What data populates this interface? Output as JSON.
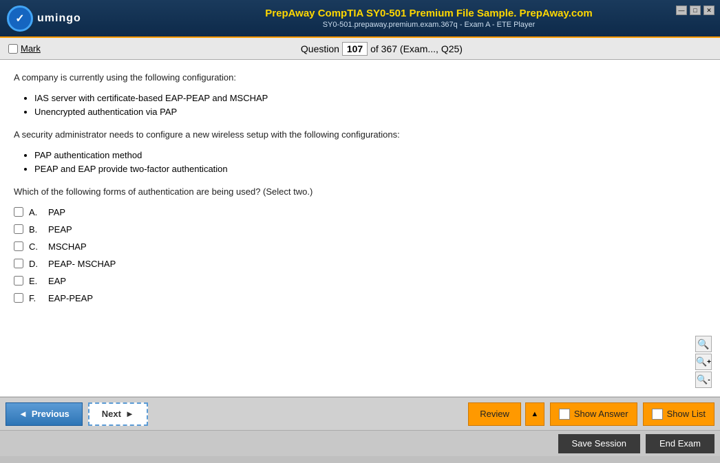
{
  "titleBar": {
    "title": "PrepAway CompTIA SY0-501 Premium File Sample. PrepAway.com",
    "subtitle": "SY0-501.prepaway.premium.exam.367q - Exam A - ETE Player",
    "controls": [
      "minimize",
      "maximize",
      "close"
    ]
  },
  "toolbar": {
    "markLabel": "Mark",
    "questionLabel": "Question",
    "questionNumber": "107",
    "questionTotal": "of 367 (Exam..., Q25)"
  },
  "question": {
    "intro": "A company is currently using the following configuration:",
    "bulletItems": [
      "IAS server with certificate-based EAP-PEAP and MSCHAP",
      "Unencrypted authentication via PAP"
    ],
    "setup": "A security administrator needs to configure a new wireless setup with the following configurations:",
    "setupBullets": [
      "PAP authentication method",
      "PEAP and EAP provide two-factor authentication"
    ],
    "prompt": "Which of the following forms of authentication are being used? (Select two.)",
    "options": [
      {
        "letter": "A.",
        "text": "PAP"
      },
      {
        "letter": "B.",
        "text": "PEAP"
      },
      {
        "letter": "C.",
        "text": "MSCHAP"
      },
      {
        "letter": "D.",
        "text": "PEAP- MSCHAP"
      },
      {
        "letter": "E.",
        "text": "EAP"
      },
      {
        "letter": "F.",
        "text": "EAP-PEAP"
      }
    ]
  },
  "bottomNav": {
    "previousLabel": "Previous",
    "nextLabel": "Next",
    "reviewLabel": "Review",
    "showAnswerLabel": "Show Answer",
    "showListLabel": "Show List",
    "saveSessionLabel": "Save Session",
    "endExamLabel": "End Exam"
  },
  "icons": {
    "prevArrow": "◄",
    "nextArrow": "►",
    "dropdownArrow": "▲",
    "search": "🔍",
    "zoomIn": "🔍+",
    "zoomOut": "🔍-",
    "minimize": "—",
    "maximize": "□",
    "close": "✕"
  }
}
